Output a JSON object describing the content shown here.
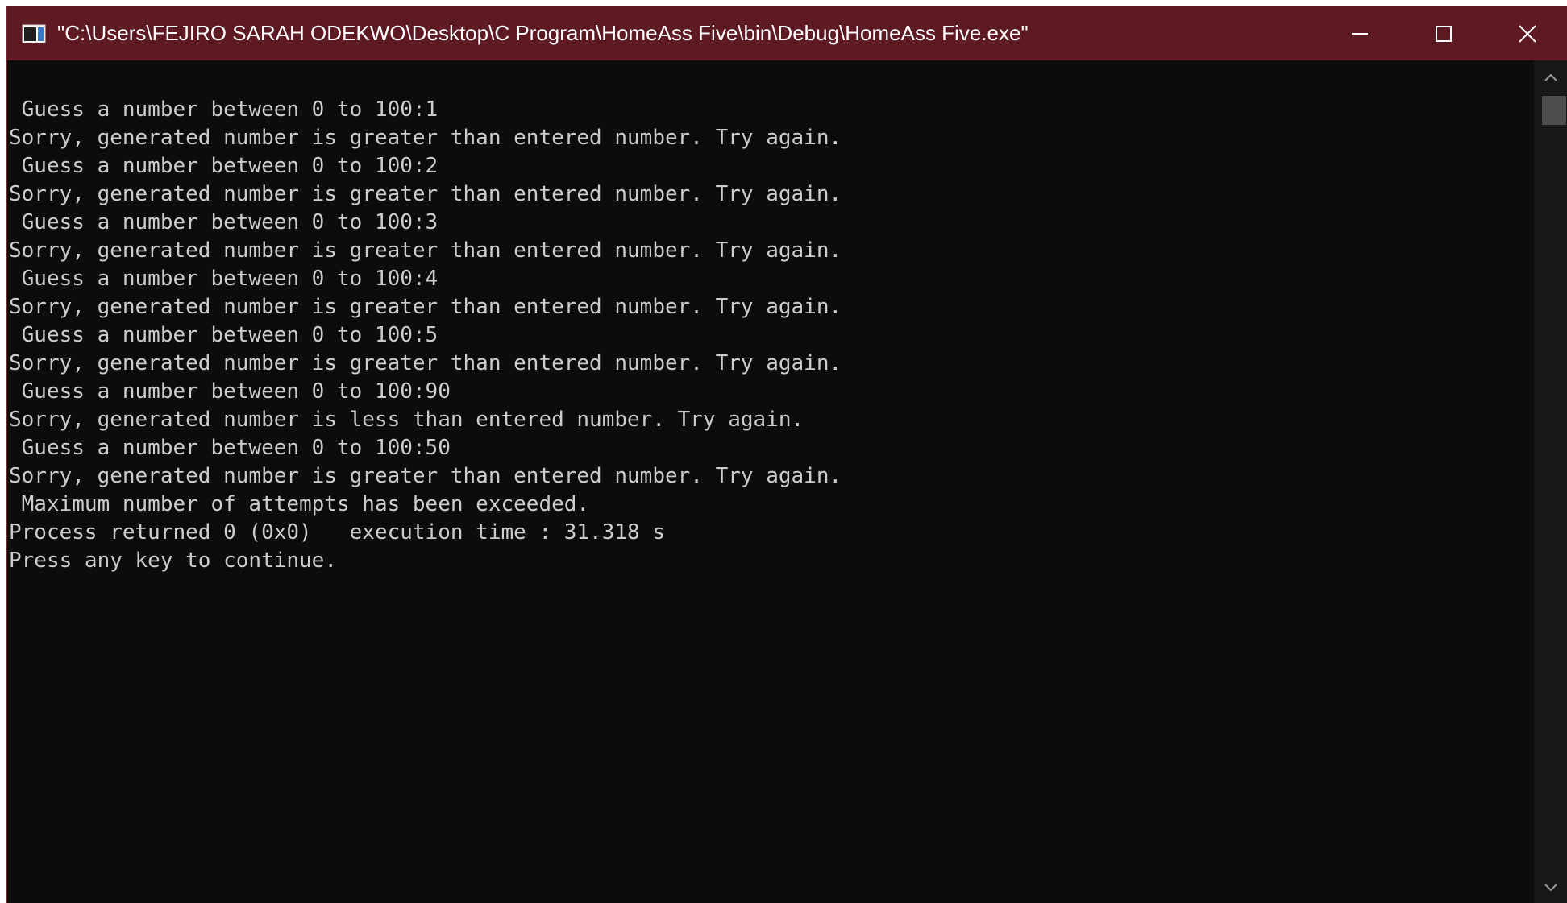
{
  "window": {
    "title": "\"C:\\Users\\FEJIRO SARAH ODEKWO\\Desktop\\C Program\\HomeAss Five\\bin\\Debug\\HomeAss Five.exe\"",
    "icon": "console-app-icon",
    "controls": {
      "minimize_icon": "minimize-icon",
      "maximize_icon": "maximize-icon",
      "close_icon": "close-icon"
    }
  },
  "console": {
    "lines": [
      " Guess a number between 0 to 100:1",
      "Sorry, generated number is greater than entered number. Try again.",
      " Guess a number between 0 to 100:2",
      "Sorry, generated number is greater than entered number. Try again.",
      " Guess a number between 0 to 100:3",
      "Sorry, generated number is greater than entered number. Try again.",
      " Guess a number between 0 to 100:4",
      "Sorry, generated number is greater than entered number. Try again.",
      " Guess a number between 0 to 100:5",
      "Sorry, generated number is greater than entered number. Try again.",
      " Guess a number between 0 to 100:90",
      "Sorry, generated number is less than entered number. Try again.",
      " Guess a number between 0 to 100:50",
      "Sorry, generated number is greater than entered number. Try again.",
      " Maximum number of attempts has been exceeded.",
      "Process returned 0 (0x0)   execution time : 31.318 s",
      "Press any key to continue."
    ]
  },
  "colors": {
    "titlebar": "#5e1a22",
    "console_bg": "#0c0c0c",
    "console_text": "#cccccc"
  }
}
